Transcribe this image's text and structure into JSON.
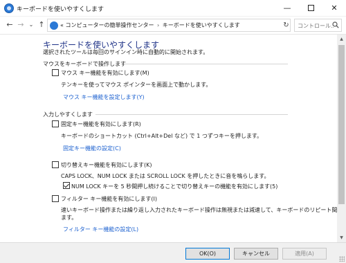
{
  "window": {
    "title": "キーボードを使いやすくします",
    "min_glyph": "—",
    "close_glyph": "✕"
  },
  "address": {
    "back_glyph": "←",
    "forward_glyph": "→",
    "recent_glyph": "⌄",
    "up_glyph": "↑",
    "prefix": "«",
    "crumbs": [
      "コンピューターの簡単操作センター",
      "キーボードを使いやすくします"
    ],
    "separator": "›",
    "dropdown_glyph": "⌄",
    "refresh_glyph": "↻",
    "search_placeholder": "コントロール..."
  },
  "page": {
    "title": "キーボードを使いやすくします",
    "description": "選択されたツールは毎回のサインイン時に自動的に開始されます。"
  },
  "sections": {
    "mouse": {
      "heading": "マウスをキーボードで操作します",
      "mouse_keys": {
        "label": "マウス キー機能を有効にします(M)",
        "checked": false,
        "description": "テンキーを使ってマウス ポインターを画面上で動かします。",
        "link": "マウス キー機能を設定します(Y)"
      }
    },
    "typing": {
      "heading": "入力しやすくします",
      "sticky_keys": {
        "label": "固定キー機能を有効にします(R)",
        "checked": false,
        "description": "キーボードのショートカット (Ctrl+Alt+Del など) で 1 つずつキーを押します。",
        "link": "固定キー機能の設定(C)"
      },
      "toggle_keys": {
        "label": "切り替えキー機能を有効にします(K)",
        "checked": false,
        "description": "CAPS LOCK、NUM LOCK または SCROLL LOCK を押したときに音を鳴らします。",
        "sub_option": {
          "label": "NUM LOCK キーを 5 秒間押し続けることで切り替えキーの機能を有効にします(5)",
          "checked": true
        }
      },
      "filter_keys": {
        "label": "フィルター キー機能を有効にします(I)",
        "checked": false,
        "description_line1": "速いキーボード操作または繰り返し入力されたキーボード操作は無視または減速して、キーボードのリピート間隔を調整し",
        "description_line2": "ます。",
        "link": "フィルター キー機能の設定(L)"
      }
    }
  },
  "buttons": {
    "ok": "OK(O)",
    "cancel": "キャンセル",
    "apply": "適用(A)"
  },
  "scrollbar": {
    "up_glyph": "▲",
    "down_glyph": "▼"
  },
  "colors": {
    "title_blue": "#1e3287",
    "link_blue": "#1a5fcf",
    "icon_blue": "#2b79d6"
  }
}
